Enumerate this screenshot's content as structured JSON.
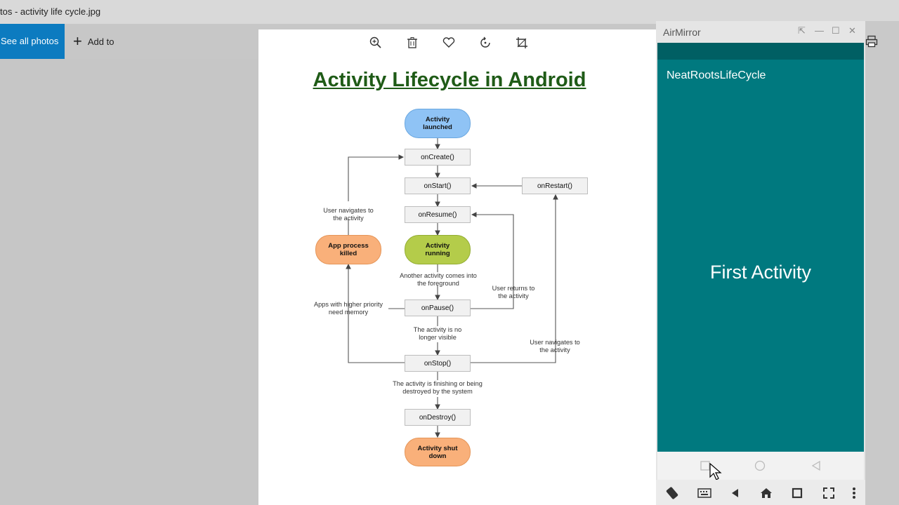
{
  "window": {
    "title": "tos - activity life cycle.jpg"
  },
  "toolbar": {
    "see_all_label": "See all photos",
    "add_to_label": "Add to"
  },
  "image_tools": [
    "zoom-icon",
    "trash-icon",
    "heart-icon",
    "rotate-icon",
    "crop-icon"
  ],
  "diagram": {
    "title": "Activity Lifecycle in Android",
    "launched": "Activity launched",
    "oncreate": "onCreate()",
    "onstart": "onStart()",
    "onrestart": "onRestart()",
    "onresume": "onResume()",
    "running": "Activity running",
    "killed": "App process killed",
    "onpause": "onPause()",
    "onstop": "onStop()",
    "ondestroy": "onDestroy()",
    "shutdown": "Activity shut down",
    "note_navigates_left": "User navigates to the activity",
    "note_another": "Another activity comes into the foreground",
    "note_returns": "User returns to the activity",
    "note_priority": "Apps with higher priority need memory",
    "note_not_visible": "The activity is no longer visible",
    "note_navigates_right": "User navigates to the activity",
    "note_finishing": "The activity is finishing or being destroyed by the system",
    "colors": {
      "blue": "#8fc3f5",
      "green": "#b4cc4a",
      "orange": "#f9b07a",
      "title": "#1f5b17"
    }
  },
  "airmirror": {
    "title": "AirMirror",
    "app_name": "NeatRootsLifeCycle",
    "screen_text": "First Activity",
    "screen_color": "#00797f"
  }
}
